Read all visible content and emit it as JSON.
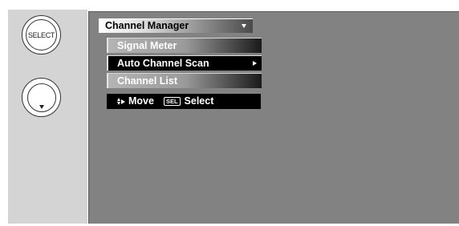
{
  "remote": {
    "select_button_label": "SELECT",
    "nav_button_icon": "down-arrow-icon"
  },
  "menu": {
    "title": "Channel Manager",
    "items": [
      {
        "label": "Signal Meter",
        "selected": false
      },
      {
        "label": "Auto Channel Scan",
        "selected": true
      },
      {
        "label": "Channel List",
        "selected": false
      }
    ]
  },
  "help": {
    "move_label": "Move",
    "sel_key": "SEL",
    "select_label": "Select"
  },
  "colors": {
    "screen_bg": "#828282",
    "panel_bg": "#d4d4d4",
    "highlight": "#000000"
  }
}
